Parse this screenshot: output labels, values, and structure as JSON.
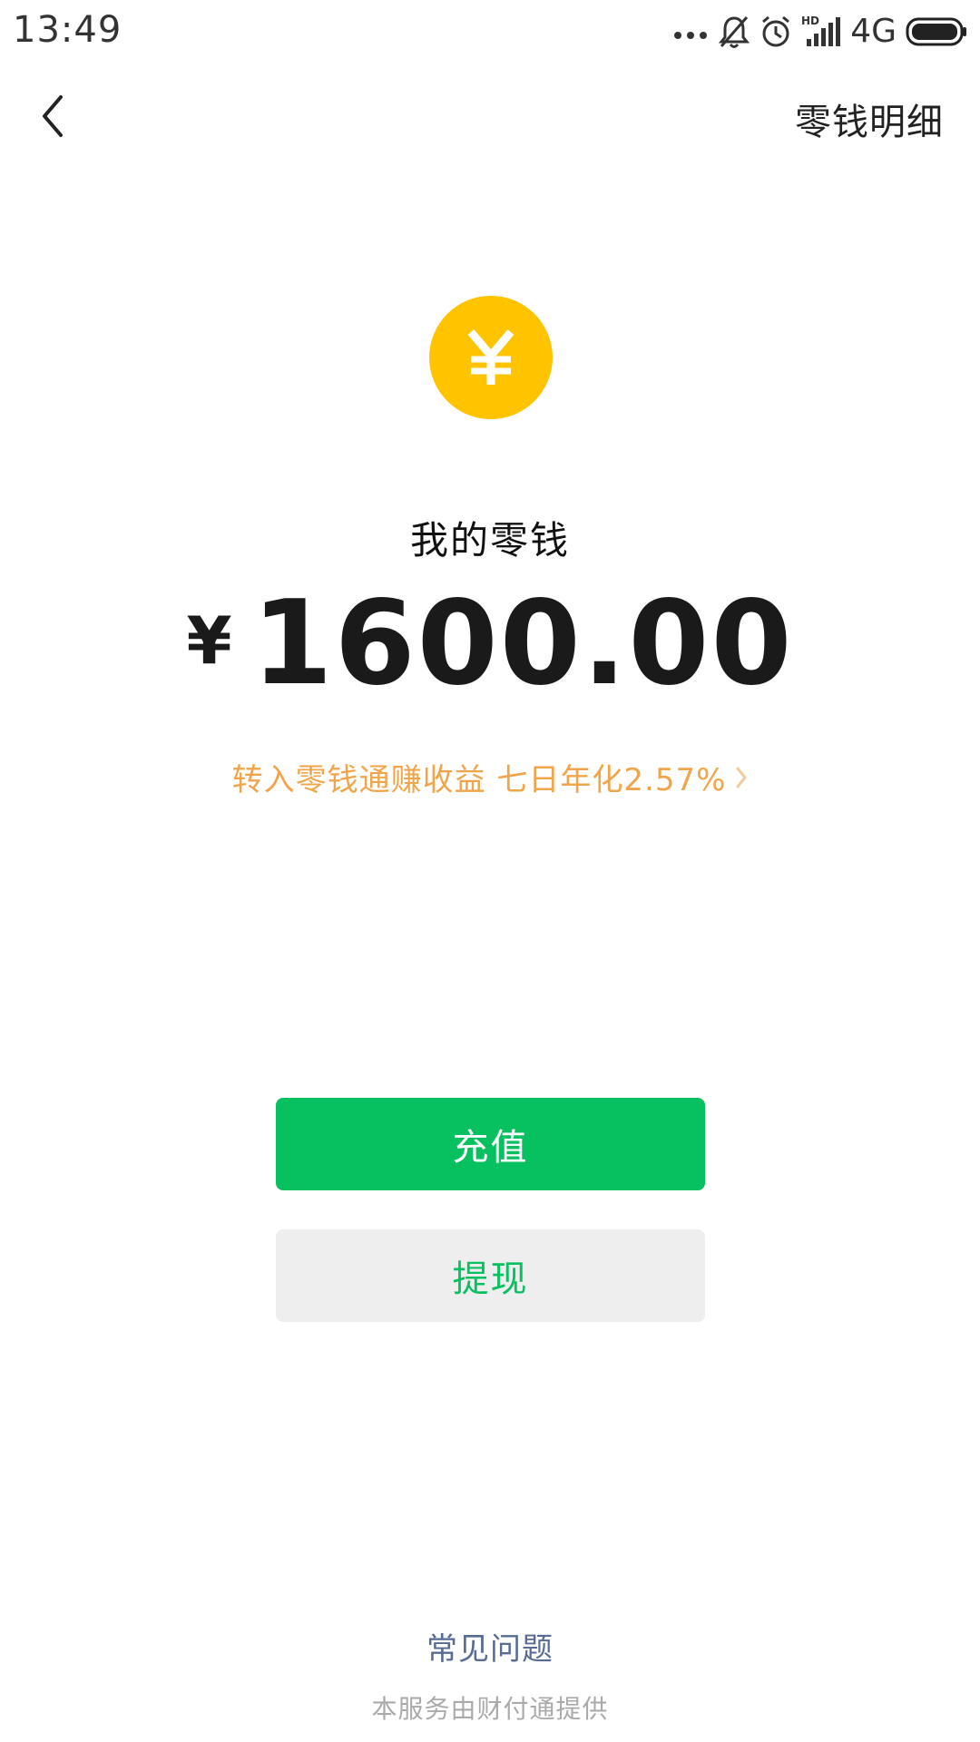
{
  "status_bar": {
    "time": "13:49",
    "network_label": "4G",
    "icons": [
      "more-dots-icon",
      "mute-bell-icon",
      "alarm-icon",
      "hd-signal-icon",
      "battery-icon"
    ]
  },
  "nav": {
    "back_icon": "chevron-left-icon",
    "details_link": "零钱明细"
  },
  "wallet": {
    "coin_icon": "yuan-coin-icon",
    "coin_color": "#FFC300",
    "label": "我的零钱",
    "currency_symbol": "¥",
    "amount": "1600.00",
    "promo_text": "转入零钱通赚收益 七日年化2.57%",
    "promo_color": "#F0A54A"
  },
  "actions": {
    "top_up_label": "充值",
    "withdraw_label": "提现",
    "accent_color": "#07C160"
  },
  "footer": {
    "faq_label": "常见问题",
    "provider_text": "本服务由财付通提供"
  }
}
